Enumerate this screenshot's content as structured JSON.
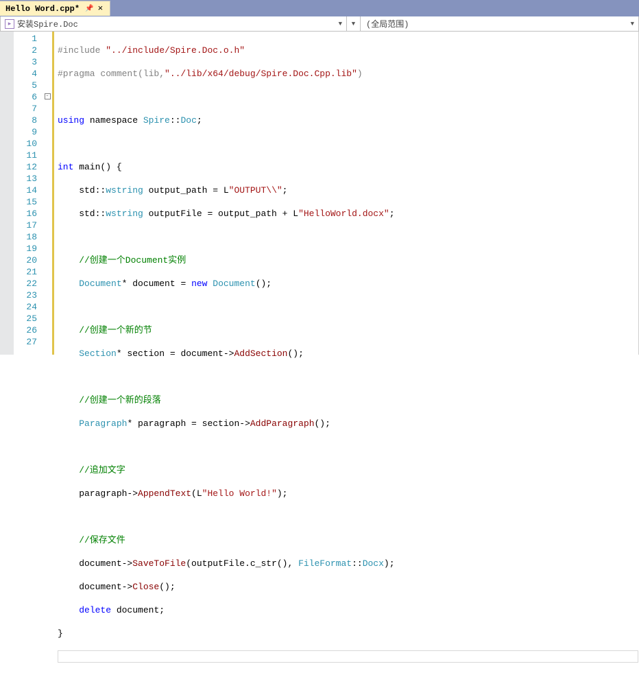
{
  "tab": {
    "title": "Hello Word.cpp*"
  },
  "dropdowns": {
    "left": "安装Spire.Doc",
    "right": "(全局范围)"
  },
  "lines": {
    "count": 27,
    "l1_a": "#include ",
    "l1_b": "\"../include/Spire.Doc.o.h\"",
    "l2_a": "#pragma comment(lib,",
    "l2_b": "\"../lib/x64/debug/Spire.Doc.Cpp.lib\"",
    "l2_c": ")",
    "l4_a": "using",
    "l4_b": " namespace ",
    "l4_c": "Spire",
    "l4_d": "::",
    "l4_e": "Doc",
    "l4_f": ";",
    "l6_a": "int",
    "l6_b": " main() {",
    "l7_a": "    std::",
    "l7_b": "wstring",
    "l7_c": " output_path = L",
    "l7_d": "\"OUTPUT\\\\\"",
    "l7_e": ";",
    "l8_a": "    std::",
    "l8_b": "wstring",
    "l8_c": " outputFile = output_path + L",
    "l8_d": "\"HelloWorld.docx\"",
    "l8_e": ";",
    "l10": "    //创建一个Document实例",
    "l11_a": "    ",
    "l11_b": "Document",
    "l11_c": "* document = ",
    "l11_d": "new",
    "l11_e": " ",
    "l11_f": "Document",
    "l11_g": "();",
    "l13": "    //创建一个新的节",
    "l14_a": "    ",
    "l14_b": "Section",
    "l14_c": "* section = document->",
    "l14_d": "AddSection",
    "l14_e": "();",
    "l16": "    //创建一个新的段落",
    "l17_a": "    ",
    "l17_b": "Paragraph",
    "l17_c": "* paragraph = section->",
    "l17_d": "AddParagraph",
    "l17_e": "();",
    "l19": "    //追加文字",
    "l20_a": "    paragraph->",
    "l20_b": "AppendText",
    "l20_c": "(L",
    "l20_d": "\"Hello World!\"",
    "l20_e": ");",
    "l22": "    //保存文件",
    "l23_a": "    document->",
    "l23_b": "SaveToFile",
    "l23_c": "(outputFile.c_str(), ",
    "l23_d": "FileFormat",
    "l23_e": "::",
    "l23_f": "Docx",
    "l23_g": ");",
    "l24_a": "    document->",
    "l24_b": "Close",
    "l24_c": "();",
    "l25_a": "    ",
    "l25_b": "delete",
    "l25_c": " document;",
    "l26": "}"
  }
}
